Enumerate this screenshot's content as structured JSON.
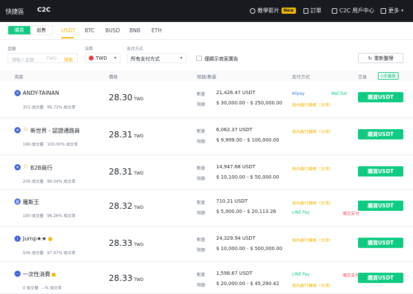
{
  "header": {
    "brand": "快捷區",
    "section": "C2C",
    "tutorial": "教學影片",
    "new_badge": "New",
    "orders": "訂單",
    "user_center": "C2C 用戶中心",
    "more": "更多"
  },
  "side_toggle": {
    "buy": "購買",
    "sell": "出售"
  },
  "coins": [
    "USDT",
    "BTC",
    "BUSD",
    "BNB",
    "ETH"
  ],
  "filters": {
    "amount_label": "金額",
    "amount_placeholder": "請輸入金額",
    "amount_currency": "TWD",
    "search": "搜索",
    "fiat_label": "法幣",
    "fiat_value": "TWD",
    "pay_label": "支付方式",
    "pay_value": "所有支付方式",
    "verified_only": "僅顯示商家廣告",
    "refresh": "重新整理"
  },
  "table_header": {
    "merchant": "商家",
    "price": "價格",
    "limit": "限額/數量",
    "payment": "支付方式",
    "trade": "交易",
    "zero_fee": "0手續費"
  },
  "labels": {
    "qty": "數量",
    "limit": "限額",
    "buy_button": "購買USDT"
  },
  "rows": [
    {
      "avatar": "A",
      "name": "ANDY-TAINAN",
      "star": false,
      "verified": false,
      "orders": "351 成交量",
      "rate": "99.72% 成交率",
      "price": "28.30",
      "unit": "TWD",
      "qty": "21,426.47 USDT",
      "limit": "$ 30,000.00 - $ 250,000.00",
      "pay_lines": [
        [
          {
            "t": "Alipay",
            "c": "blue"
          },
          {
            "t": "WeChat",
            "c": "green"
          },
          {
            "t": "面交支付",
            "c": "red"
          }
        ],
        [
          {
            "t": "境內銀行轉帳（台灣）",
            "c": "yellow"
          }
        ]
      ]
    },
    {
      "avatar": "★",
      "name": "新世界 - 認證通路商",
      "star": true,
      "verified": false,
      "orders": "186 成交量",
      "rate": "100.00% 成交率",
      "price": "28.31",
      "unit": "TWD",
      "qty": "6,062.37 USDT",
      "limit": "$ 9,999.00 - $ 100,000.00",
      "pay_lines": [
        [
          {
            "t": "境內銀行轉帳（台灣）",
            "c": "yellow"
          }
        ]
      ]
    },
    {
      "avatar": "★",
      "name": "B2B商行",
      "star": true,
      "verified": false,
      "orders": "206 成交量",
      "rate": "99.04% 成交率",
      "price": "28.31",
      "unit": "TWD",
      "qty": "14,947.68 USDT",
      "limit": "$ 10,100.00 - $ 50,000.00",
      "pay_lines": [
        [
          {
            "t": "境內銀行轉帳（台灣）",
            "c": "yellow"
          }
        ]
      ]
    },
    {
      "avatar": "羅",
      "name": "羅斯王",
      "star": false,
      "verified": false,
      "orders": "180 成交量",
      "rate": "96.26% 成交率",
      "price": "28.32",
      "unit": "TWD",
      "qty": "710.21 USDT",
      "limit": "$ 5,000.00 - $ 20,113.26",
      "pay_lines": [
        [
          {
            "t": "境內銀行轉帳（台灣）",
            "c": "yellow"
          }
        ],
        [
          {
            "t": "LINE Pay",
            "c": "green"
          },
          {
            "t": "面交支付",
            "c": "red"
          }
        ]
      ]
    },
    {
      "avatar": "J",
      "name": "Jump★★",
      "star": false,
      "verified": true,
      "orders": "506 成交量",
      "rate": "97.87% 成交率",
      "price": "28.33",
      "unit": "TWD",
      "qty": "24,329.94 USDT",
      "limit": "$ 10,000.00 - $ 500,000.00",
      "pay_lines": [
        [
          {
            "t": "境內銀行轉帳（台灣）",
            "c": "yellow"
          }
        ]
      ]
    },
    {
      "avatar": "一",
      "name": "一次性消費",
      "star": false,
      "verified": true,
      "orders": "0 成交量",
      "rate": "--% 成交率",
      "price": "28.33",
      "unit": "TWD",
      "qty": "1,598.67 USDT",
      "limit": "$ 20,000.00 - $ 45,290.42",
      "pay_lines": [
        [
          {
            "t": "LINE Pay",
            "c": "green"
          },
          {
            "t": "面交支付",
            "c": "red"
          }
        ],
        [
          {
            "t": "境內銀行轉帳（台灣）",
            "c": "yellow"
          }
        ]
      ]
    }
  ]
}
